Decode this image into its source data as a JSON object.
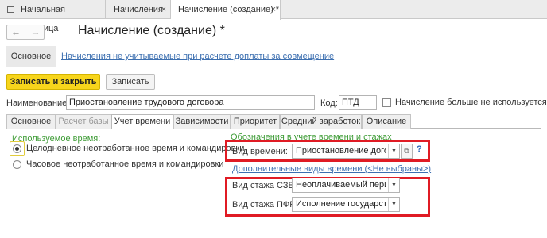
{
  "window_tabs": [
    {
      "label": "Начальная страница",
      "closable": false
    },
    {
      "label": "Начисления",
      "closable": true
    },
    {
      "label": "Начисление (создание) *",
      "closable": true
    }
  ],
  "close_glyph": "×",
  "nav": {
    "back_glyph": "←",
    "forward_glyph": "→"
  },
  "page_title": "Начисление (создание) *",
  "sections": {
    "main": "Основное",
    "link": "Начисления не учитываемые при расчете доплаты за совмещение"
  },
  "buttons": {
    "save_close": "Записать и закрыть",
    "save": "Записать"
  },
  "form": {
    "name_label": "Наименование:",
    "name_value": "Приостановление трудового договора",
    "code_label": "Код:",
    "code_value": "ПТД",
    "not_used_label": "Начисление больше не используется",
    "not_used_checked": false
  },
  "inner_tabs": [
    {
      "label": "Основное",
      "state": "normal"
    },
    {
      "label": "Расчет базы",
      "state": "disabled"
    },
    {
      "label": "Учет времени",
      "state": "selected"
    },
    {
      "label": "Зависимости",
      "state": "normal"
    },
    {
      "label": "Приоритет",
      "state": "normal"
    },
    {
      "label": "Средний заработок",
      "state": "normal"
    },
    {
      "label": "Описание",
      "state": "normal"
    }
  ],
  "time_used": {
    "title": "Используемое время:",
    "options": [
      {
        "label": "Целодневное неотработанное время и командировки",
        "selected": true
      },
      {
        "label": "Часовое неотработанное время и командировки",
        "selected": false
      }
    ]
  },
  "designation": {
    "title": "Обозначения в учете времени и стажах",
    "time_kind_label": "Вид времени:",
    "time_kind_value": "Приостановление договора",
    "help_glyph": "?",
    "extra_link": "Дополнительные виды времени (<Не выбраны>)",
    "szv_label": "Вид стажа СЗВ:",
    "szv_value": "Неоплачиваемый период",
    "pfr_label": "Вид стажа ПФР:",
    "pfr_value": "Исполнение государственных обязанностей"
  },
  "colors": {
    "accent_green": "#3e9c36",
    "link_blue": "#3c6fb0",
    "primary_yellow": "#f7d51c",
    "highlight_red": "#e01b24"
  }
}
